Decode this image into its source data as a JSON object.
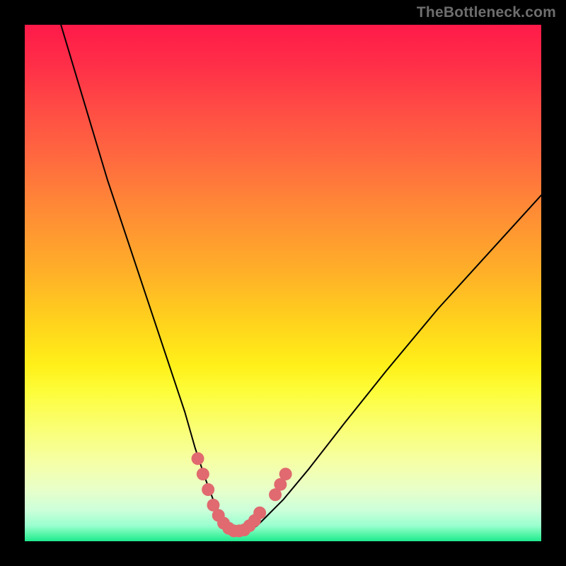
{
  "watermark": "TheBottleneck.com",
  "chart_data": {
    "type": "line",
    "title": "",
    "xlabel": "",
    "ylabel": "",
    "xlim": [
      0,
      100
    ],
    "ylim": [
      0,
      100
    ],
    "grid": false,
    "legend": false,
    "series": [
      {
        "name": "bottleneck-curve",
        "x": [
          7,
          10,
          13,
          16,
          20,
          24,
          28,
          31,
          33,
          35,
          36.5,
          38,
          39.5,
          41,
          43,
          45,
          47,
          50,
          55,
          62,
          70,
          80,
          90,
          100
        ],
        "y": [
          100,
          90,
          80,
          70,
          58,
          46,
          34,
          25,
          18,
          12,
          8,
          5,
          3,
          2,
          2,
          3,
          5,
          8,
          14,
          23,
          33,
          45,
          56,
          67
        ]
      }
    ],
    "green_band_y": [
      0,
      3
    ],
    "markers": {
      "name": "highlight-dots",
      "color": "#e06a6f",
      "radius_px": 9,
      "points": [
        {
          "x": 33.5,
          "y": 16
        },
        {
          "x": 34.5,
          "y": 13
        },
        {
          "x": 35.5,
          "y": 10
        },
        {
          "x": 36.5,
          "y": 7
        },
        {
          "x": 37.5,
          "y": 5
        },
        {
          "x": 38.5,
          "y": 3.5
        },
        {
          "x": 39.5,
          "y": 2.5
        },
        {
          "x": 40.5,
          "y": 2
        },
        {
          "x": 41.5,
          "y": 2
        },
        {
          "x": 42.5,
          "y": 2.2
        },
        {
          "x": 43.5,
          "y": 3
        },
        {
          "x": 44.5,
          "y": 4
        },
        {
          "x": 45.5,
          "y": 5.5
        },
        {
          "x": 48.5,
          "y": 9
        },
        {
          "x": 49.5,
          "y": 11
        },
        {
          "x": 50.5,
          "y": 13
        }
      ]
    }
  }
}
